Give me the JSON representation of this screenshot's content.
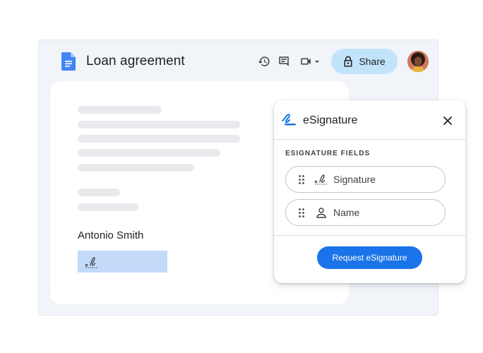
{
  "app": {
    "doc_title": "Loan agreement",
    "share_label": "Share",
    "toolbar_icons": [
      "history-icon",
      "comment-icon",
      "video-call-icon",
      "chevron-down-icon"
    ]
  },
  "document": {
    "signer_name": "Antonio Smith",
    "signature_field_icon": "signature-icon"
  },
  "panel": {
    "title": "eSignature",
    "fields_header": "ESIGNATURE FIELDS",
    "fields": [
      {
        "label": "Signature",
        "icon": "signature-icon"
      },
      {
        "label": "Name",
        "icon": "person-icon"
      }
    ],
    "request_button": "Request eSignature"
  },
  "colors": {
    "accent": "#1a73e8",
    "share_bg": "#c2e4fb",
    "signature_field": "#c3daf9",
    "window_bg": "#f1f4f9"
  }
}
